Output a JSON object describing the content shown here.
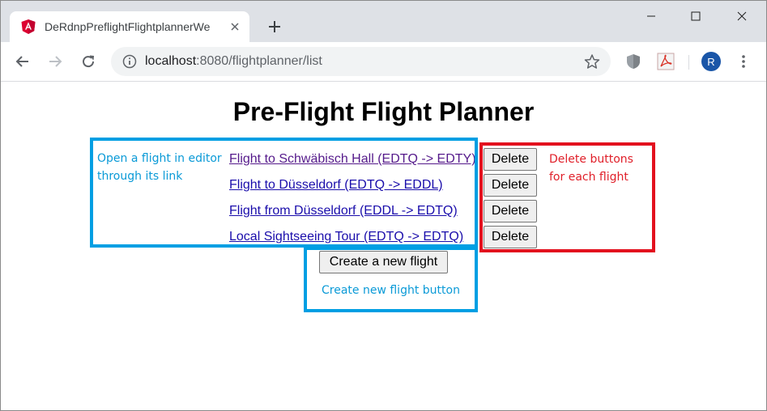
{
  "browser": {
    "tab": {
      "title": "DeRdnpPreflightFlightplannerWe",
      "favicon": "angular-icon"
    },
    "url": {
      "host": "localhost",
      "path": ":8080/flightplanner/list"
    },
    "profile_initial": "R",
    "colors": {
      "tabstrip": "#dee1e6",
      "avatar": "#1a56a8"
    }
  },
  "page": {
    "title": "Pre-Flight Flight Planner",
    "flights": [
      {
        "label": "Flight to Schwäbisch Hall (EDTQ -> EDTY)",
        "delete_label": "Delete"
      },
      {
        "label": "Flight to Düsseldorf (EDTQ -> EDDL)",
        "delete_label": "Delete"
      },
      {
        "label": "Flight from Düsseldorf (EDDL -> EDTQ)",
        "delete_label": "Delete"
      },
      {
        "label": "Local Sightseeing Tour (EDTQ -> EDTQ)",
        "delete_label": "Delete"
      }
    ],
    "create_button": "Create a new flight"
  },
  "annotations": {
    "open_flight": "Open a flight in editor through its link",
    "delete_buttons": "Delete buttons for each flight",
    "create_button": "Create new flight button",
    "colors": {
      "blue": "#009fe3",
      "red": "#e3101e"
    }
  }
}
